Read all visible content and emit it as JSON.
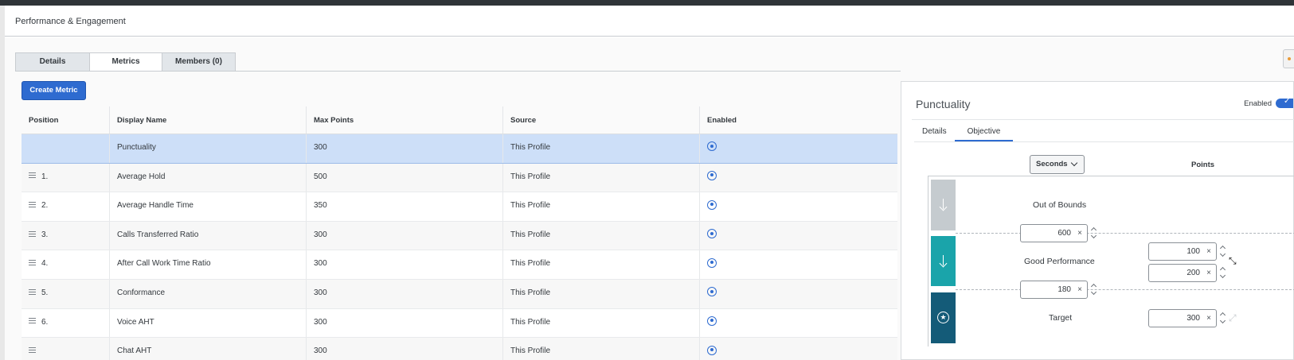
{
  "app": {
    "title": "Performance & Engagement"
  },
  "tabs": [
    {
      "label": "Details",
      "active": false
    },
    {
      "label": "Metrics",
      "active": true
    },
    {
      "label": "Members (0)",
      "active": false
    }
  ],
  "create_metric_label": "Create Metric",
  "table": {
    "headers": [
      "Position",
      "Display Name",
      "Max Points",
      "Source",
      "Enabled"
    ],
    "rows": [
      {
        "position": "",
        "name": "Punctuality",
        "max_points": "300",
        "source": "This Profile",
        "selected": true
      },
      {
        "position": "1.",
        "name": "Average Hold",
        "max_points": "500",
        "source": "This Profile"
      },
      {
        "position": "2.",
        "name": "Average Handle Time",
        "max_points": "350",
        "source": "This Profile"
      },
      {
        "position": "3.",
        "name": "Calls Transferred Ratio",
        "max_points": "300",
        "source": "This Profile"
      },
      {
        "position": "4.",
        "name": "After Call Work Time Ratio",
        "max_points": "300",
        "source": "This Profile"
      },
      {
        "position": "5.",
        "name": "Conformance",
        "max_points": "300",
        "source": "This Profile"
      },
      {
        "position": "6.",
        "name": "Voice AHT",
        "max_points": "300",
        "source": "This Profile"
      },
      {
        "position": "",
        "name": "Chat AHT",
        "max_points": "300",
        "source": "This Profile"
      }
    ]
  },
  "panel": {
    "title": "Punctuality",
    "enabled_label": "Enabled",
    "tabs": [
      {
        "label": "Details",
        "active": false
      },
      {
        "label": "Objective",
        "active": true
      }
    ],
    "unit": "Seconds",
    "points_header": "Points",
    "bands": {
      "out_of_bounds": "Out of Bounds",
      "good_performance": "Good Performance",
      "target": "Target"
    },
    "thresholds": {
      "upper": "600",
      "lower": "180"
    },
    "points": {
      "good_min": "100",
      "good_max": "200",
      "target": "300"
    },
    "clear_glyph": "×",
    "target_glyph": "★"
  },
  "colors": {
    "accent": "#2e6bd0",
    "band_out_of_bounds": "#c5cbcf",
    "band_good": "#1aa4aa",
    "band_target": "#145b78",
    "selected_row": "#cddff8"
  }
}
